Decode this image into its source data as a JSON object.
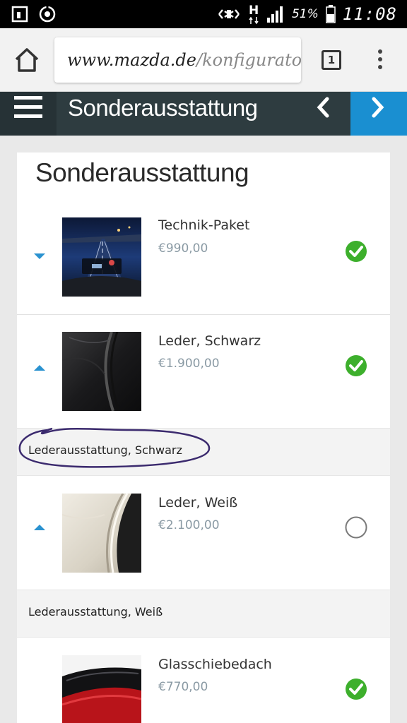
{
  "statusbar": {
    "battery": "51%",
    "time": "11:08",
    "network": "H",
    "icons": [
      "notification-square-icon",
      "sync-icon",
      "mute-icon",
      "signal-icon",
      "battery-icon"
    ]
  },
  "browser": {
    "url_domain": "www.mazda.de",
    "url_path": "/konfigurato",
    "tab_count": "1",
    "icons": [
      "home-icon",
      "tabs-icon",
      "overflow-menu-icon"
    ]
  },
  "nav": {
    "title": "Sonderausstattung",
    "icons": [
      "hamburger-icon",
      "chevron-left-icon",
      "chevron-right-icon"
    ],
    "accent": "#1a8fd1",
    "bar_color": "#2e3c40"
  },
  "page": {
    "title": "Sonderausstattung"
  },
  "items": [
    {
      "name": "Technik-Paket",
      "price": "€990,00",
      "selected": true,
      "expanded": false,
      "description": ""
    },
    {
      "name": "Leder, Schwarz",
      "price": "€1.900,00",
      "selected": true,
      "expanded": true,
      "description": "Lederausstattung, Schwarz"
    },
    {
      "name": "Leder, Weiß",
      "price": "€2.100,00",
      "selected": false,
      "expanded": true,
      "description": "Lederausstattung, Weiß"
    },
    {
      "name": "Glasschiebedach",
      "price": "€770,00",
      "selected": true,
      "expanded": false,
      "description": ""
    }
  ],
  "colors": {
    "check_green": "#3daf2c",
    "arrow_blue": "#2a92d0",
    "annotation_purple": "#3b2a6e"
  }
}
